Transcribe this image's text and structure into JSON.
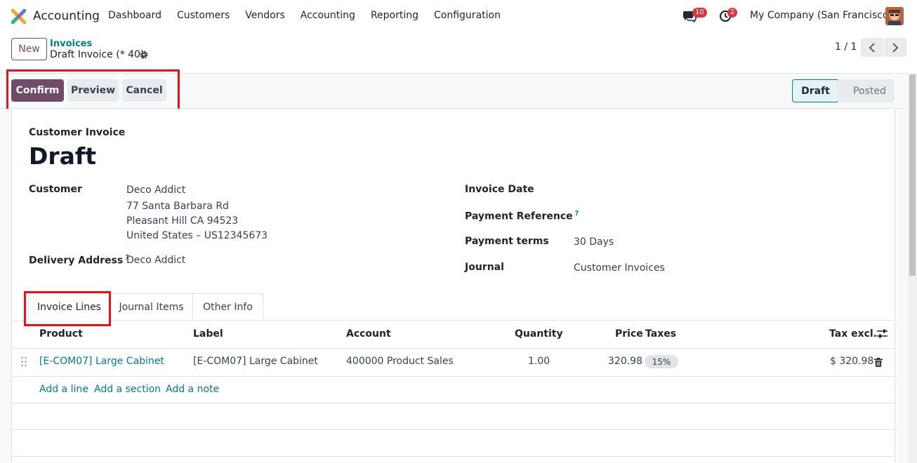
{
  "navbar": {
    "app_name": "Accounting",
    "menu": [
      "Dashboard",
      "Customers",
      "Vendors",
      "Accounting",
      "Reporting",
      "Configuration"
    ],
    "chat_badge": "10",
    "activity_badge": "2",
    "company": "My Company (San Francisco)"
  },
  "control_panel": {
    "new_label": "New",
    "breadcrumb_parent": "Invoices",
    "breadcrumb_current": "Draft Invoice (* 40)",
    "pager_value": "1 / 1"
  },
  "statusbar": {
    "confirm_label": "Confirm",
    "preview_label": "Preview",
    "cancel_label": "Cancel",
    "stages": [
      "Draft",
      "Posted"
    ],
    "active_stage": "Draft"
  },
  "form": {
    "move_type": "Customer Invoice",
    "title": "Draft",
    "customer_label": "Customer",
    "customer_name": "Deco Addict",
    "customer_address": [
      "77 Santa Barbara Rd",
      "Pleasant Hill CA 94523",
      "United States – US12345673"
    ],
    "delivery_label": "Delivery Address",
    "delivery_value": "Deco Addict",
    "invoice_date_label": "Invoice Date",
    "payment_ref_label": "Payment Reference",
    "payment_terms_label": "Payment terms",
    "payment_terms_value": "30 Days",
    "journal_label": "Journal",
    "journal_value": "Customer Invoices",
    "help_mark": "?"
  },
  "tabs": [
    "Invoice Lines",
    "Journal Items",
    "Other Info"
  ],
  "lines_table": {
    "headers": [
      "Product",
      "Label",
      "Account",
      "Quantity",
      "Price",
      "Taxes",
      "Tax excl."
    ],
    "rows": [
      {
        "product": "[E-COM07] Large Cabinet",
        "label": "[E-COM07] Large Cabinet",
        "account": "400000 Product Sales",
        "quantity": "1.00",
        "price": "320.98",
        "taxes": "15%",
        "subtotal": "$ 320.98"
      }
    ],
    "add_links": [
      "Add a line",
      "Add a section",
      "Add a note"
    ]
  },
  "colors": {
    "brand": "#714b67",
    "link": "#017e84",
    "highlight": "#e5141b"
  }
}
